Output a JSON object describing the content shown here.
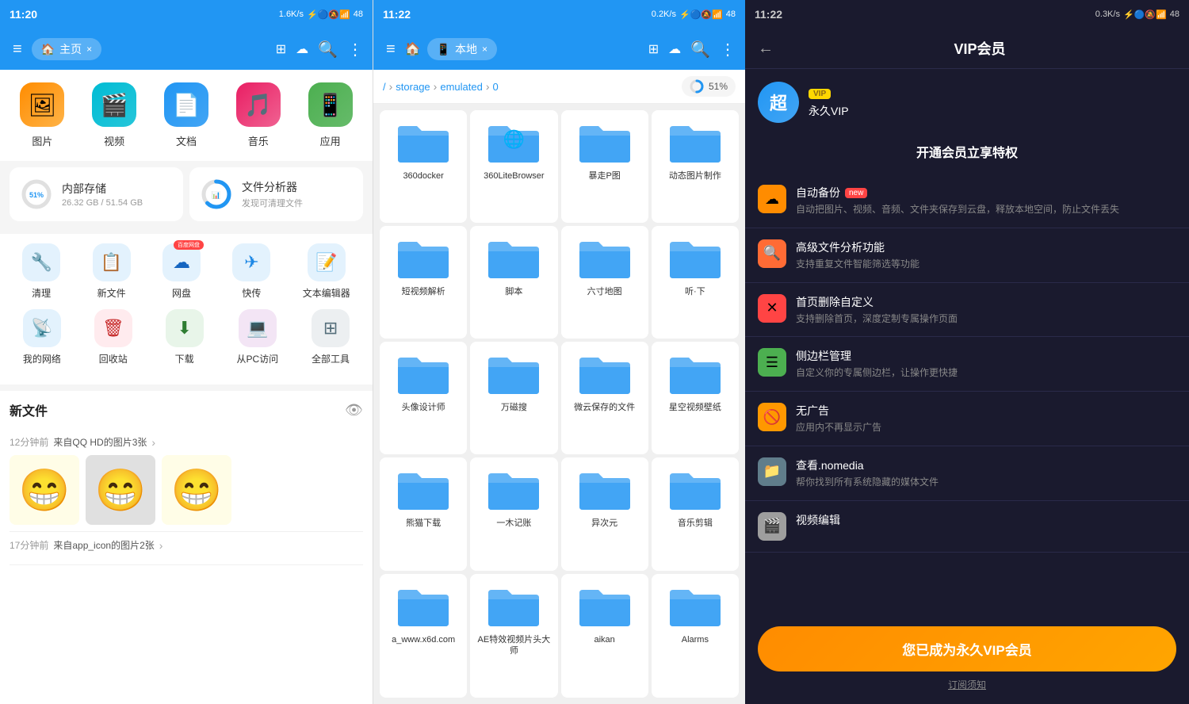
{
  "panel1": {
    "status": {
      "time": "11:20",
      "network": "1.6K/s",
      "battery": "48"
    },
    "nav": {
      "menu": "≡",
      "tab_home": "主页",
      "close": "×"
    },
    "categories": [
      {
        "id": "img",
        "label": "图片",
        "emoji": "🖼",
        "class": "cat-img"
      },
      {
        "id": "vid",
        "label": "视频",
        "emoji": "🎬",
        "class": "cat-vid"
      },
      {
        "id": "doc",
        "label": "文档",
        "emoji": "📄",
        "class": "cat-doc"
      },
      {
        "id": "mus",
        "label": "音乐",
        "emoji": "🎵",
        "class": "cat-mus"
      },
      {
        "id": "app",
        "label": "应用",
        "emoji": "📱",
        "class": "cat-app"
      }
    ],
    "storage": {
      "internal": {
        "title": "内部存储",
        "used": "26.32 GB / 51.54 GB",
        "percent": 51
      },
      "analyzer": {
        "title": "文件分析器",
        "sub": "发现可清理文件"
      }
    },
    "tools_row1": [
      {
        "id": "clean",
        "label": "清理",
        "emoji": "🔧",
        "class": "t-clean"
      },
      {
        "id": "newfile",
        "label": "新文件",
        "emoji": "📋",
        "class": "t-newfile"
      },
      {
        "id": "cloud",
        "label": "网盘",
        "emoji": "☁",
        "class": "t-cloud",
        "badge": "百度网盘"
      },
      {
        "id": "transfer",
        "label": "快传",
        "emoji": "✈",
        "class": "t-transfer"
      },
      {
        "id": "text",
        "label": "文本编辑器",
        "emoji": "📝",
        "class": "t-text"
      }
    ],
    "tools_row2": [
      {
        "id": "network",
        "label": "我的网络",
        "emoji": "📡",
        "class": "t-network"
      },
      {
        "id": "trash",
        "label": "回收站",
        "emoji": "🗑",
        "class": "t-trash"
      },
      {
        "id": "download",
        "label": "下载",
        "emoji": "⬇",
        "class": "t-download"
      },
      {
        "id": "pcaccess",
        "label": "从PC访问",
        "emoji": "💻",
        "class": "t-pc"
      },
      {
        "id": "alltools",
        "label": "全部工具",
        "emoji": "⊞",
        "class": "t-all"
      }
    ],
    "newfiles": {
      "title": "新文件",
      "items": [
        {
          "time": "12分钟前",
          "source": "来自QQ HD的图片3张",
          "thumbs": [
            "😁",
            "😁",
            "😁"
          ]
        },
        {
          "time": "17分钟前",
          "source": "来自app_icon的图片2张"
        }
      ]
    }
  },
  "panel2": {
    "status": {
      "time": "11:22",
      "network": "0.2K/s",
      "battery": "48"
    },
    "nav": {
      "menu": "≡",
      "tab_local": "本地",
      "close": "×"
    },
    "breadcrumb": [
      "/",
      "storage",
      "emulated",
      "0"
    ],
    "usage": "51%",
    "folders": [
      {
        "name": "360docker",
        "has_app": false,
        "app_emoji": null
      },
      {
        "name": "360LiteBrowser",
        "has_app": true,
        "app_emoji": "🌐"
      },
      {
        "name": "暴走P图",
        "has_app": false
      },
      {
        "name": "动态图片制作",
        "has_app": false
      },
      {
        "name": "短视频解析",
        "has_app": false
      },
      {
        "name": "脚本",
        "has_app": false
      },
      {
        "name": "六寸地图",
        "has_app": false
      },
      {
        "name": "听·下",
        "has_app": false
      },
      {
        "name": "头像设计师",
        "has_app": false
      },
      {
        "name": "万磁搜",
        "has_app": false
      },
      {
        "name": "微云保存的文件",
        "has_app": false
      },
      {
        "name": "星空视频壁纸",
        "has_app": false
      },
      {
        "name": "熊猫下载",
        "has_app": false
      },
      {
        "name": "一木记账",
        "has_app": false
      },
      {
        "name": "异次元",
        "has_app": false
      },
      {
        "name": "音乐剪辑",
        "has_app": false
      },
      {
        "name": "a_www.x6d.com",
        "has_app": false
      },
      {
        "name": "AE特效视频片头大师",
        "has_app": false
      },
      {
        "name": "aikan",
        "has_app": false
      },
      {
        "name": "Alarms",
        "has_app": false
      }
    ]
  },
  "panel3": {
    "status": {
      "time": "11:22",
      "network": "0.3K/s",
      "battery": "48"
    },
    "title": "VIP会员",
    "avatar_letter": "超",
    "vip_label": "VIP",
    "username": "永久VIP",
    "promo_title": "开通会员立享特权",
    "features": [
      {
        "id": "backup",
        "title": "自动备份",
        "is_new": true,
        "desc": "自动把图片、视频、音频、文件夹保存到云盘，释放本地空间，防止文件丢失",
        "class": "fi-backup",
        "emoji": "☁"
      },
      {
        "id": "analyze",
        "title": "高级文件分析功能",
        "is_new": false,
        "desc": "支持重复文件智能筛选等功能",
        "class": "fi-analyze",
        "emoji": "🔍"
      },
      {
        "id": "delete",
        "title": "首页删除自定义",
        "is_new": false,
        "desc": "支持删除首页，深度定制专属操作页面",
        "class": "fi-delete",
        "emoji": "✕"
      },
      {
        "id": "sidebar",
        "title": "侧边栏管理",
        "is_new": false,
        "desc": "自定义你的专属侧边栏，让操作更快捷",
        "class": "fi-sidebar",
        "emoji": "☰"
      },
      {
        "id": "noad",
        "title": "无广告",
        "is_new": false,
        "desc": "应用内不再显示广告",
        "class": "fi-noad",
        "emoji": "🚫"
      },
      {
        "id": "nomedia",
        "title": "查看.nomedia",
        "is_new": false,
        "desc": "帮你找到所有系统隐藏的媒体文件",
        "class": "fi-nomedia",
        "emoji": "📁"
      },
      {
        "id": "videoedit",
        "title": "视频编辑",
        "is_new": false,
        "desc": "",
        "class": "fi-video",
        "emoji": "🎬"
      }
    ],
    "button_label": "您已成为永久VIP会员",
    "sub_text": "订阅须知"
  }
}
